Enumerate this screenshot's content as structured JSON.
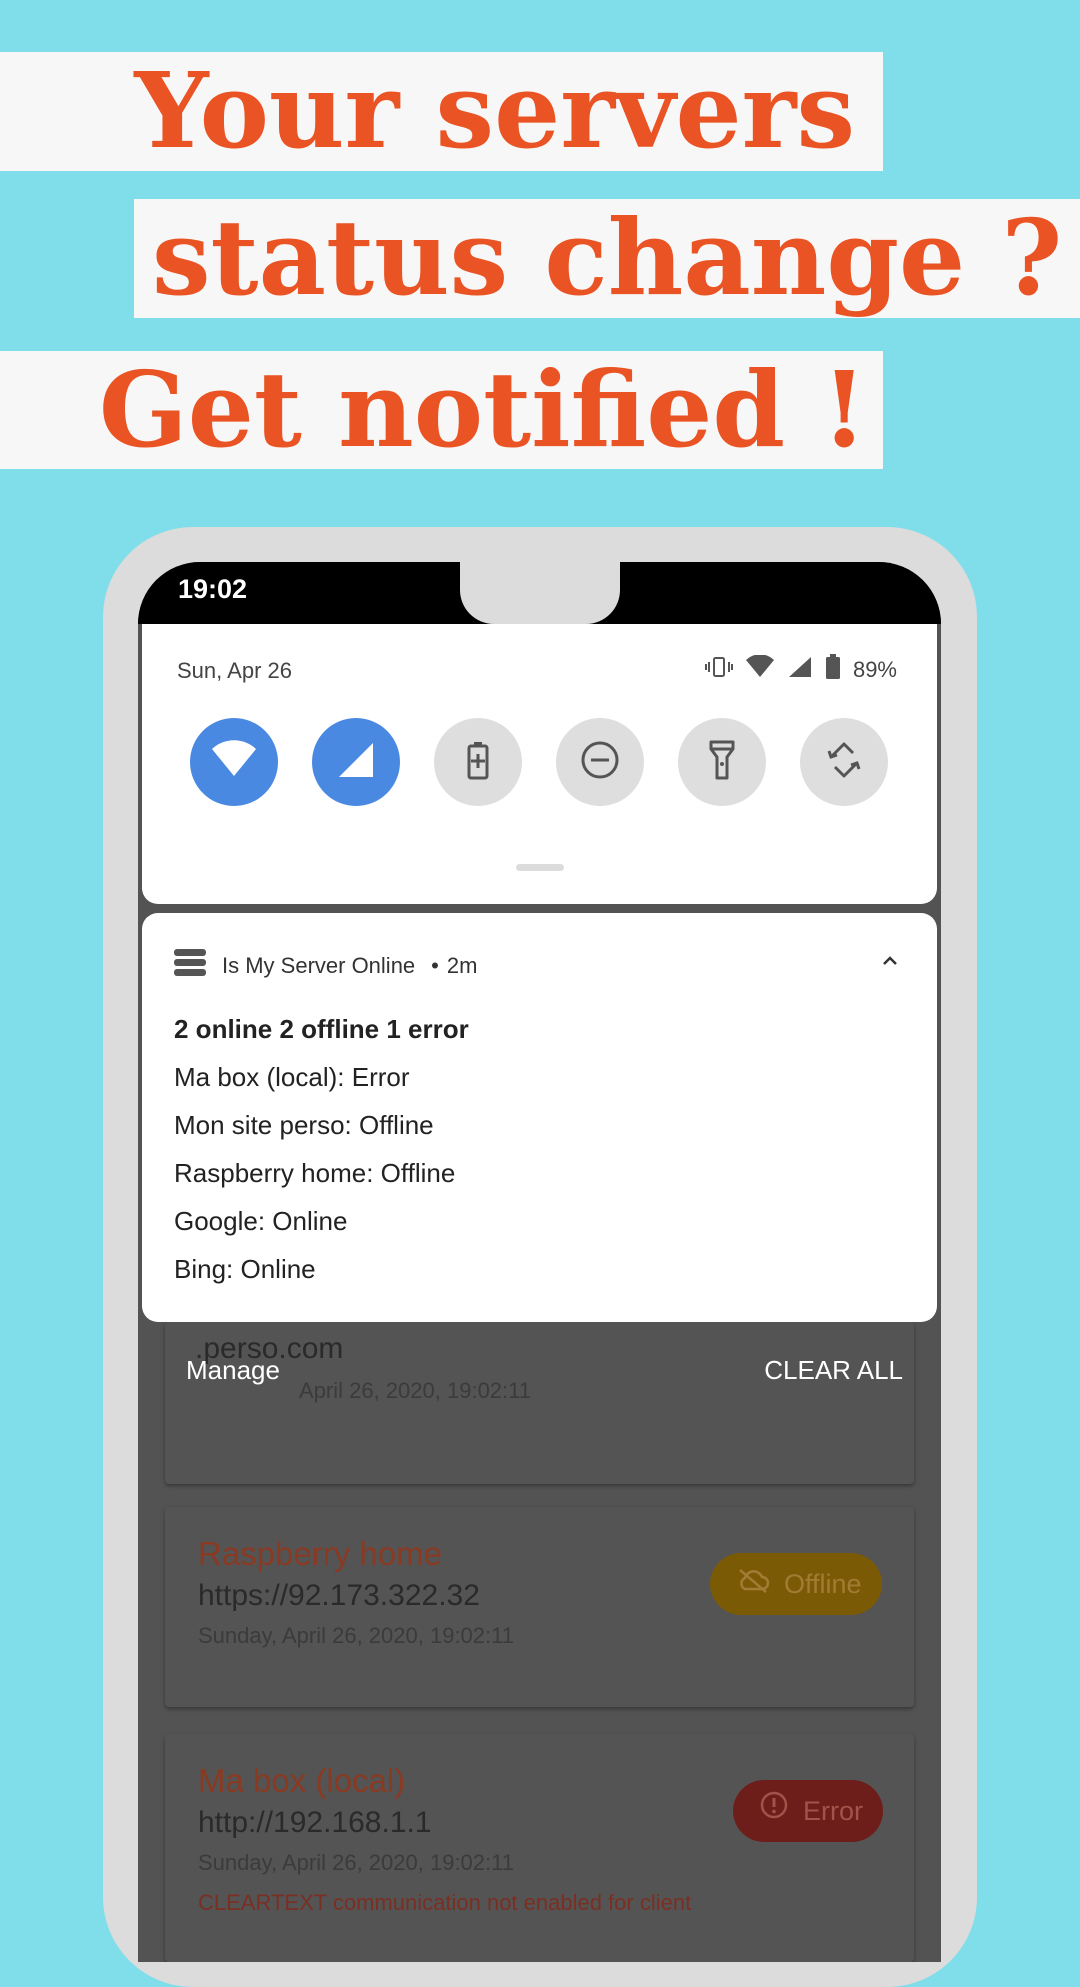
{
  "headline": {
    "line1": "Your servers",
    "line2": "status change ?",
    "line3": "Get notified !"
  },
  "status_bar": {
    "time": "19:02"
  },
  "quick_settings": {
    "date": "Sun, Apr 26",
    "battery": "89%",
    "tiles": [
      "wifi-icon",
      "cellular-signal-icon",
      "battery-saver-icon",
      "do-not-disturb-icon",
      "flashlight-icon",
      "auto-rotate-icon"
    ]
  },
  "notification": {
    "app_name": "Is My Server Online",
    "time_ago": "2m",
    "summary": "2 online 2 offline 1 error",
    "lines": [
      "Ma box (local): Error",
      "Mon site perso: Offline",
      "Raspberry home: Offline",
      "Google: Online",
      "Bing: Online"
    ]
  },
  "shade_actions": {
    "manage": "Manage",
    "clear_all": "CLEAR ALL"
  },
  "cards": [
    {
      "url_partial": ".perso.com",
      "date_partial": "April 26, 2020, 19:02:11"
    },
    {
      "name": "Raspberry home",
      "url": "https://92.173.322.32",
      "date": "Sunday, April 26, 2020, 19:02:11",
      "status": "Offline"
    },
    {
      "name": "Ma box (local)",
      "url": "http://192.168.1.1",
      "date": "Sunday, April 26, 2020, 19:02:11",
      "status": "Error",
      "error": "CLEARTEXT communication not enabled for client"
    }
  ],
  "colors": {
    "background": "#7fdeea",
    "headline_text": "#ea5323",
    "tile_active": "#4a89e1"
  }
}
